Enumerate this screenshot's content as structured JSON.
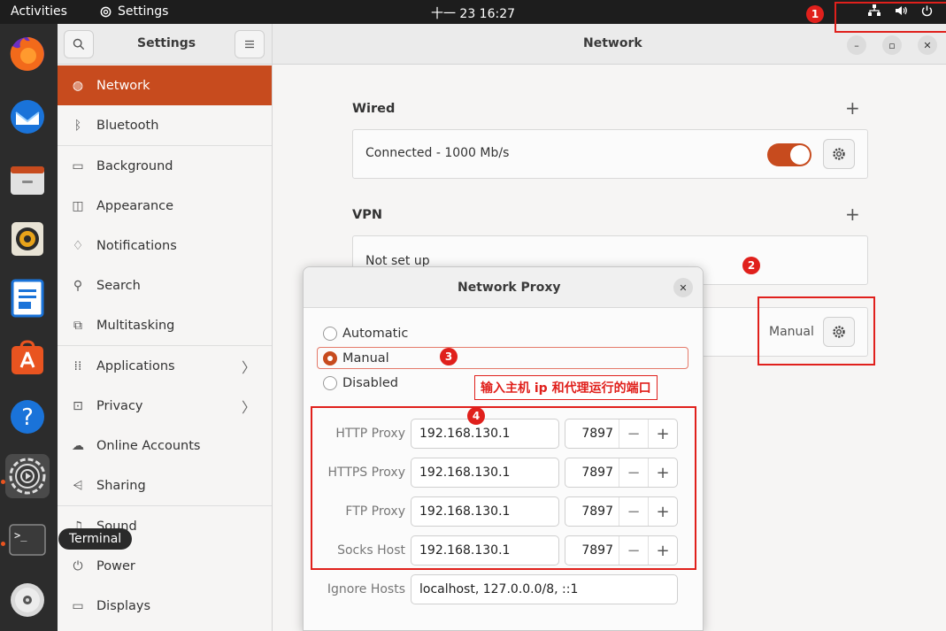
{
  "topbar": {
    "activities": "Activities",
    "app_name": "Settings",
    "clock": "十一 23  16:27"
  },
  "dock_tooltip": "Terminal",
  "sidebar": {
    "title": "Settings",
    "items": [
      {
        "label": "Network",
        "icon": "globe-icon"
      },
      {
        "label": "Bluetooth",
        "icon": "bluetooth-icon"
      },
      {
        "label": "Background",
        "icon": "background-icon"
      },
      {
        "label": "Appearance",
        "icon": "appearance-icon"
      },
      {
        "label": "Notifications",
        "icon": "bell-icon"
      },
      {
        "label": "Search",
        "icon": "search-icon"
      },
      {
        "label": "Multitasking",
        "icon": "multitasking-icon"
      },
      {
        "label": "Applications",
        "icon": "grid-icon"
      },
      {
        "label": "Privacy",
        "icon": "lock-icon"
      },
      {
        "label": "Online Accounts",
        "icon": "cloud-icon"
      },
      {
        "label": "Sharing",
        "icon": "share-icon"
      },
      {
        "label": "Sound",
        "icon": "music-icon"
      },
      {
        "label": "Power",
        "icon": "power-icon"
      },
      {
        "label": "Displays",
        "icon": "display-icon"
      }
    ]
  },
  "main": {
    "title": "Network",
    "wired": {
      "title": "Wired",
      "status": "Connected - 1000 Mb/s"
    },
    "vpn": {
      "title": "VPN",
      "status": "Not set up"
    },
    "proxy": {
      "status": "Manual"
    }
  },
  "dialog": {
    "title": "Network Proxy",
    "modes": [
      "Automatic",
      "Manual",
      "Disabled"
    ],
    "selected_mode": "Manual",
    "rows": [
      {
        "label": "HTTP Proxy",
        "host": "192.168.130.1",
        "port": "7897"
      },
      {
        "label": "HTTPS Proxy",
        "host": "192.168.130.1",
        "port": "7897"
      },
      {
        "label": "FTP Proxy",
        "host": "192.168.130.1",
        "port": "7897"
      },
      {
        "label": "Socks Host",
        "host": "192.168.130.1",
        "port": "7897"
      }
    ],
    "ignore": {
      "label": "Ignore Hosts",
      "value": "localhost, 127.0.0.0/8, ::1"
    }
  },
  "annotations": {
    "n1": "1",
    "n2": "2",
    "n3": "3",
    "n4": "4",
    "note": "输入主机 ip 和代理运行的端口"
  },
  "colors": {
    "accent": "#c74b1e",
    "annotation": "#e0201c"
  }
}
